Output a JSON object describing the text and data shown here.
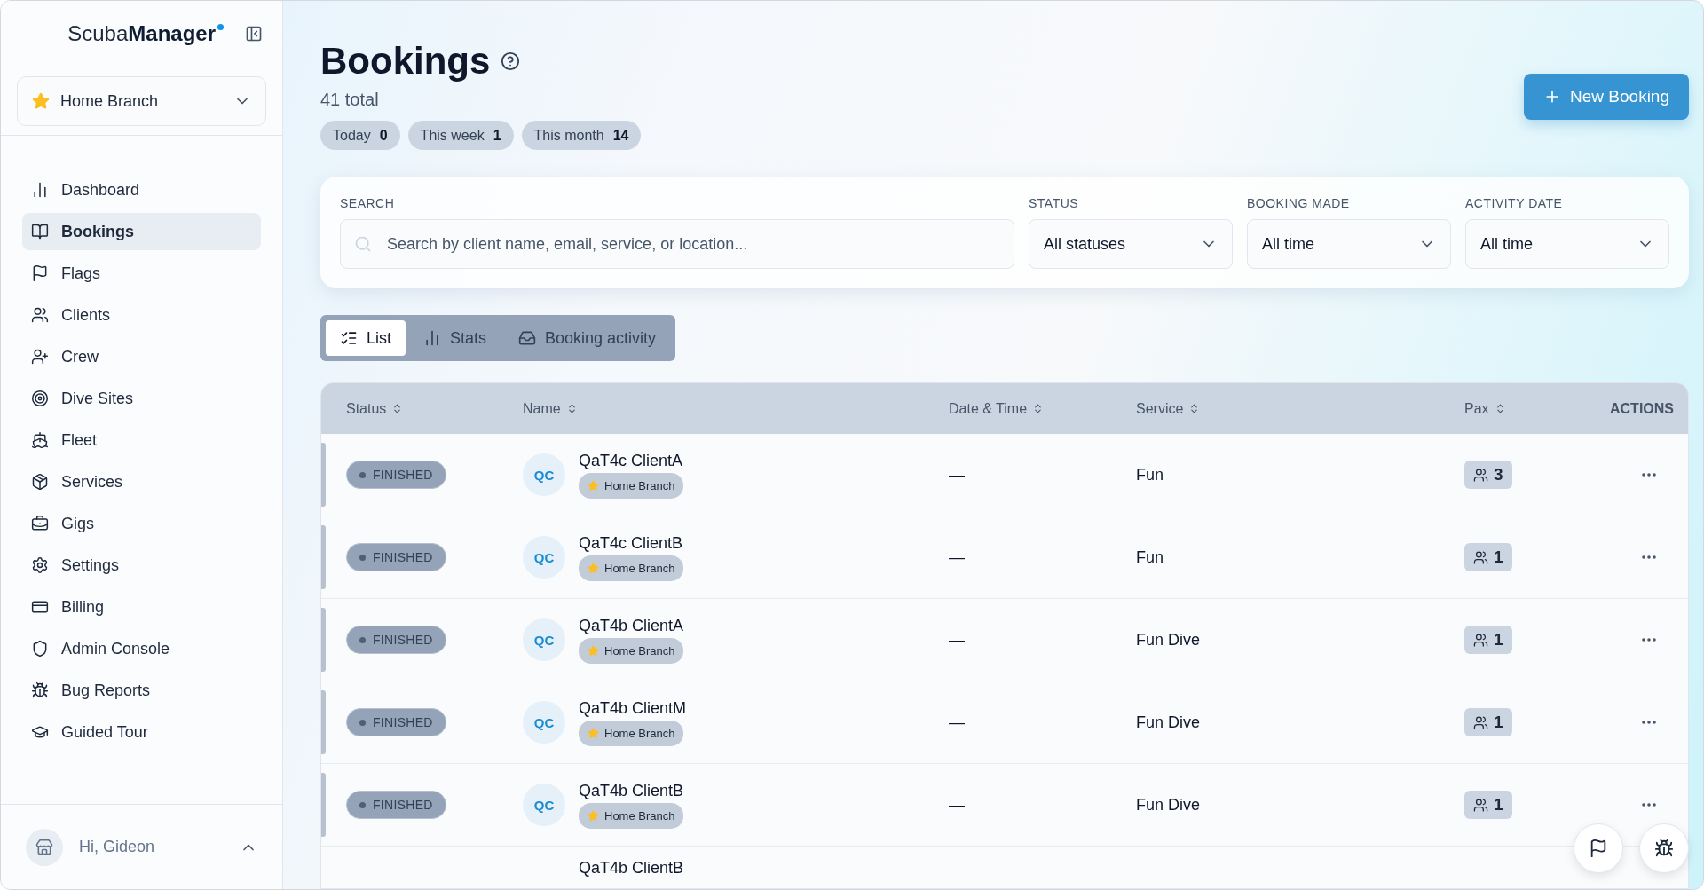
{
  "sidebar": {
    "logo": "Scuba**Manager**",
    "branch": "Home Branch",
    "items": [
      {
        "label": "Dashboard",
        "selected": false
      },
      {
        "label": "Bookings",
        "selected": true
      },
      {
        "label": "Flags",
        "selected": false
      },
      {
        "label": "Clients",
        "selected": false
      },
      {
        "label": "Crew",
        "selected": false
      },
      {
        "label": "Dive Sites",
        "selected": false
      },
      {
        "label": "Fleet",
        "selected": false
      },
      {
        "label": "Services",
        "selected": false
      },
      {
        "label": "Gigs",
        "selected": false
      },
      {
        "label": "Settings",
        "selected": false
      },
      {
        "label": "Billing",
        "selected": false
      },
      {
        "label": "Admin Console",
        "selected": false
      },
      {
        "label": "Bug Reports",
        "selected": false
      },
      {
        "label": "Guided Tour",
        "selected": false
      }
    ],
    "user": "Hi, Gideon"
  },
  "header": {
    "title": "Bookings",
    "total": "41 total",
    "new_button": "New Booking",
    "counts": [
      {
        "label": "Today",
        "value": "0"
      },
      {
        "label": "This week",
        "value": "1"
      },
      {
        "label": "This month",
        "value": "14"
      }
    ]
  },
  "filters": {
    "search": {
      "label": "SEARCH",
      "placeholder": "Search by client name, email, service, or location..."
    },
    "selects": [
      {
        "label": "STATUS",
        "value": "All statuses"
      },
      {
        "label": "BOOKING MADE",
        "value": "All time"
      },
      {
        "label": "ACTIVITY DATE",
        "value": "All time"
      }
    ]
  },
  "tabs": [
    {
      "label": "List",
      "selected": true
    },
    {
      "label": "Stats",
      "selected": false
    },
    {
      "label": "Booking activity",
      "selected": false
    }
  ],
  "table": {
    "columns": [
      {
        "label": "Status",
        "sortable": true
      },
      {
        "label": "Name",
        "sortable": true
      },
      {
        "label": "Date & Time",
        "sortable": true
      },
      {
        "label": "Service",
        "sortable": true
      },
      {
        "label": "Pax",
        "sortable": true
      },
      {
        "label": "ACTIONS",
        "sortable": false
      }
    ],
    "rows": [
      {
        "status": "FINISHED",
        "initials": "QC",
        "name": "QaT4c ClientA",
        "branch": "Home Branch",
        "date": "—",
        "service": "Fun",
        "pax": "3"
      },
      {
        "status": "FINISHED",
        "initials": "QC",
        "name": "QaT4c ClientB",
        "branch": "Home Branch",
        "date": "—",
        "service": "Fun",
        "pax": "1"
      },
      {
        "status": "FINISHED",
        "initials": "QC",
        "name": "QaT4b ClientA",
        "branch": "Home Branch",
        "date": "—",
        "service": "Fun Dive",
        "pax": "1"
      },
      {
        "status": "FINISHED",
        "initials": "QC",
        "name": "QaT4b ClientM",
        "branch": "Home Branch",
        "date": "—",
        "service": "Fun Dive",
        "pax": "1"
      },
      {
        "status": "FINISHED",
        "initials": "QC",
        "name": "QaT4b ClientB",
        "branch": "Home Branch",
        "date": "—",
        "service": "Fun Dive",
        "pax": "1"
      }
    ],
    "partial_row": {
      "name": "QaT4b ClientB"
    }
  }
}
